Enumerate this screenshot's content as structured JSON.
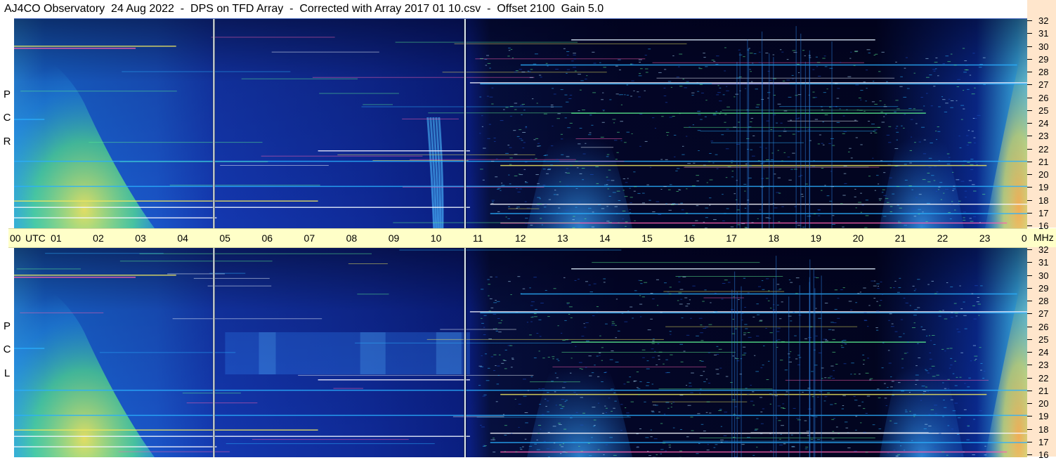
{
  "title": "AJ4CO Observatory  24 Aug 2022  -  DPS on TFD Array  -  Corrected with Array 2017 01 10.csv  -  Offset 2100  Gain 5.0",
  "polarizations": {
    "top": [
      "R",
      "C",
      "P"
    ],
    "bottom": [
      "L",
      "C",
      "P"
    ]
  },
  "time_axis": {
    "labels": [
      "00",
      "UTC",
      "01",
      "02",
      "03",
      "04",
      "05",
      "06",
      "07",
      "08",
      "09",
      "10",
      "11",
      "12",
      "13",
      "14",
      "15",
      "16",
      "17",
      "18",
      "19",
      "20",
      "21",
      "22",
      "23",
      "00",
      "MHz"
    ]
  },
  "colors": {
    "night": "#000830",
    "deep_blue": "#0a1f8a",
    "blue": "#1a4ec8",
    "cyan": "#2ab0ff",
    "green": "#5af090",
    "yellow": "#f0e860",
    "orange": "#ffb050",
    "pink": "#ff60b0",
    "marker": "#e8f4ff"
  },
  "chart_data": {
    "type": "heatmap",
    "title": "AJ4CO Observatory  24 Aug 2022  -  DPS on TFD Array  -  Corrected with Array 2017 01 10.csv  -  Offset 2100  Gain 5.0",
    "x_axis": {
      "unit": "UTC",
      "range": [
        0,
        24
      ],
      "ticks": [
        "00",
        "01",
        "02",
        "03",
        "04",
        "05",
        "06",
        "07",
        "08",
        "09",
        "10",
        "11",
        "12",
        "13",
        "14",
        "15",
        "16",
        "17",
        "18",
        "19",
        "20",
        "21",
        "22",
        "23",
        "00"
      ]
    },
    "y_axis": {
      "unit": "MHz",
      "range": [
        16,
        32
      ],
      "ticks": [
        16,
        17,
        18,
        19,
        20,
        21,
        22,
        23,
        24,
        25,
        26,
        27,
        28,
        29,
        30,
        31,
        32
      ]
    },
    "panels": [
      {
        "polarization": "RCP"
      },
      {
        "polarization": "LCP"
      }
    ],
    "vertical_markers_utc": [
      4.9,
      10.85
    ]
  }
}
